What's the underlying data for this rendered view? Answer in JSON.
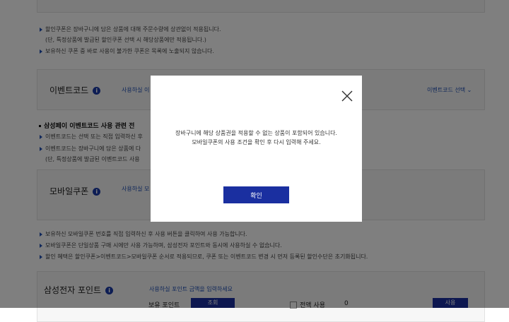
{
  "background": {
    "coupon_notes": [
      "할인쿠폰은 장바구니에 담은 상품에 대해 주문수량에 상관없이 적용됩니다.",
      "(단, 특정상품에 발급된 할인쿠폰 선택 시 해당상품에만 적용됩니다.)",
      "보유하신 쿠폰 중 바로 사용이 불가한 쿠폰은 목록에 노출되지 않습니다."
    ],
    "event_code": {
      "title": "이벤트코드",
      "hint": "사용하실 이",
      "dropdown_label": "이벤트코드 선택"
    },
    "samsung_pay_heading": "삼성페이 이벤트코드 사용 관련 전",
    "event_notes": [
      "이벤트코드는 선택 또는 직접 입력하신 후",
      "이벤트코드는 장바구니에 담은 상품에 다",
      "(단, 특정상품에 발급된 이벤트코드 사용"
    ],
    "mobile_coupon": {
      "title": "모바일쿠폰",
      "hint": "사용하실 모"
    },
    "mobile_notes": [
      "보유하신 모바일쿠폰 번호를 직접 입력하신 후 사용 버튼을 클릭하여 사용 가능합니다.",
      "모바일쿠폰은 단일상품 구매 시에만 사용 가능하며, 삼성전자 포인트와 동시에 사용하실 수 없습니다.",
      "할인 혜택은 할인쿠폰>이벤트코드>모바일쿠폰 순서로 적용되므로, 쿠폰 또는 이벤트코드 변경 시 먼저 등록된 할인수단은 초기화됩니다."
    ],
    "points": {
      "title": "삼성전자 포인트",
      "hint": "사용하실 포인트 금액을 입력하세요",
      "owned_label": "보유 포인트",
      "inquiry_button": "조회",
      "use_all_label": "전액 사용",
      "amount_value": "0",
      "use_button": "사용"
    }
  },
  "modal": {
    "message_line1": "장바구니에 해당 상품권을 적용할 수 없는 상품이 포함되어 있습니다.",
    "message_line2": "모바일쿠폰의 사용 조건을 확인 후 다시 입력해 주세요.",
    "confirm_label": "확인"
  },
  "colors": {
    "navy": "#1a2fa0",
    "accent_blue": "#1f4fb5",
    "overlay": "rgba(0,0,0,0.5)"
  }
}
